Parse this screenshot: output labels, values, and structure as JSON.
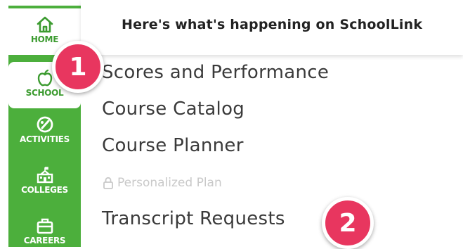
{
  "header": {
    "title": "Here's what's happening on SchoolLink"
  },
  "sidebar": {
    "items": [
      {
        "label": "HOME",
        "icon": "home-icon"
      },
      {
        "label": "SCHOOL",
        "icon": "apple-icon"
      },
      {
        "label": "ACTIVITIES",
        "icon": "activities-icon"
      },
      {
        "label": "COLLEGES",
        "icon": "college-icon"
      },
      {
        "label": "CAREERS",
        "icon": "briefcase-icon"
      }
    ]
  },
  "menu": {
    "items": [
      "Scores and Performance",
      "Course Catalog",
      "Course Planner",
      "Personalized Plan",
      "Transcript Requests"
    ]
  },
  "badges": [
    "1",
    "2"
  ],
  "colors": {
    "accent": "#4caf3c",
    "badge": "#e8365f"
  }
}
